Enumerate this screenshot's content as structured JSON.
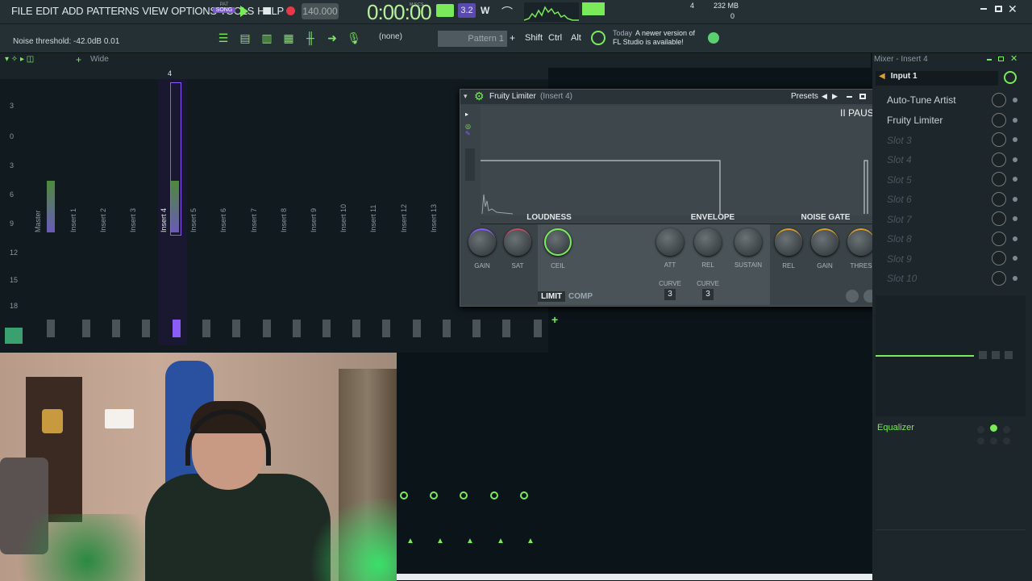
{
  "menu": [
    "FILE",
    "EDIT",
    "ADD",
    "PATTERNS",
    "VIEW",
    "OPTIONS",
    "TOOLS",
    "HELP"
  ],
  "transport": {
    "pat_label": "PAT",
    "song_label": "SONG",
    "tempo": "140.000",
    "time": "0:00:00",
    "time_unit": "M:S:CS",
    "numbers": [
      "4",
      "0"
    ],
    "memory": "232 MB",
    "step": "3.2"
  },
  "hint": {
    "text": "Noise threshold: -42.0dB  0.01"
  },
  "toolbar": {
    "none_select": "(none)",
    "pattern": "Pattern 1",
    "plus": "+",
    "shift": "Shift",
    "ctrl": "Ctrl",
    "alt": "Alt",
    "news_today": "Today",
    "news_text1": "A newer version of",
    "news_text2": "FL Studio is available!"
  },
  "browser": {
    "wide": "Wide"
  },
  "mixer": {
    "db_scale": [
      "3",
      "0",
      "3",
      "6",
      "9",
      "12",
      "15",
      "18"
    ],
    "tracks": [
      "Master",
      "Insert 1",
      "Insert 2",
      "Insert 3",
      "Insert 4",
      "Insert 5",
      "Insert 6",
      "Insert 7",
      "Insert 8",
      "Insert 9",
      "Insert 10",
      "Insert 11",
      "Insert 12",
      "Insert 13"
    ],
    "ruler_mark": "4",
    "add": "+"
  },
  "limiter": {
    "title": "Fruity Limiter",
    "subtitle": "(Insert 4)",
    "presets": "Presets",
    "pause": "II PAUSE",
    "sections": [
      "LOUDNESS",
      "ENVELOPE",
      "NOISE GATE"
    ],
    "knobs": {
      "gain": "GAIN",
      "sat": "SAT",
      "ceil": "CEIL",
      "att": "ATT",
      "rel": "REL",
      "sustain": "SUSTAIN",
      "ng_rel": "REL",
      "ng_gain": "GAIN",
      "thres": "THRES"
    },
    "curve_label": "CURVE",
    "curve_att": "3",
    "curve_rel": "3",
    "mode_limit": "LIMIT",
    "mode_comp": "COMP"
  },
  "mixer_right": {
    "title": "Mixer - Insert 4",
    "input": "Input 1",
    "slots": [
      "Auto-Tune Artist",
      "Fruity Limiter",
      "Slot 3",
      "Slot 4",
      "Slot 5",
      "Slot 6",
      "Slot 7",
      "Slot 8",
      "Slot 9",
      "Slot 10"
    ],
    "equalizer": "Equalizer"
  },
  "colors": {
    "accent": "#7bea5a",
    "purple": "#8b5cf6",
    "bg": "#0b1418",
    "panel": "#253035"
  }
}
